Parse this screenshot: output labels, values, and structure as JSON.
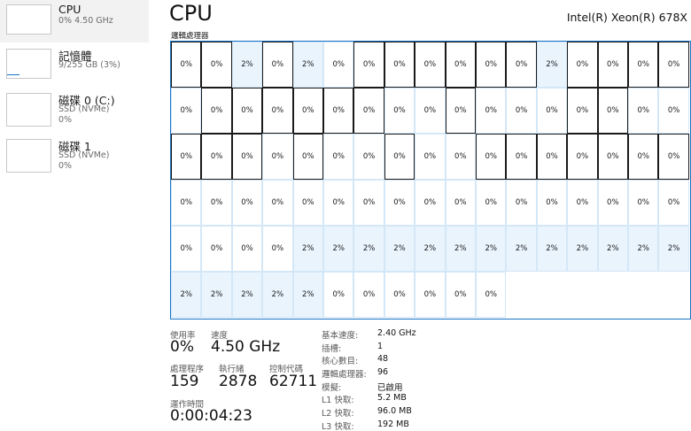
{
  "sidebar": {
    "items": [
      {
        "title": "CPU",
        "sub1": "0% 4.50 GHz",
        "sub2": ""
      },
      {
        "title": "記憶體",
        "sub1": "9/255 GB (3%)",
        "sub2": ""
      },
      {
        "title": "磁碟 0 (C:)",
        "sub1": "SSD (NVMe)",
        "sub2": "0%"
      },
      {
        "title": "磁碟 1",
        "sub1": "SSD (NVMe)",
        "sub2": "0%"
      }
    ]
  },
  "header": {
    "title": "CPU",
    "model": "Intel(R) Xeon(R) 678X"
  },
  "grid": {
    "label": "邏輯處理器",
    "cells": [
      "0%",
      "0%",
      "2%",
      "0%",
      "2%",
      "0%",
      "0%",
      "0%",
      "0%",
      "0%",
      "0%",
      "0%",
      "2%",
      "0%",
      "0%",
      "0%",
      "0%",
      "0%",
      "0%",
      "0%",
      "0%",
      "0%",
      "0%",
      "0%",
      "0%",
      "0%",
      "0%",
      "0%",
      "0%",
      "0%",
      "0%",
      "0%",
      "0%",
      "0%",
      "0%",
      "0%",
      "0%",
      "0%",
      "0%",
      "0%",
      "0%",
      "0%",
      "0%",
      "0%",
      "0%",
      "0%",
      "0%",
      "0%",
      "0%",
      "0%",
      "0%",
      "0%",
      "0%",
      "0%",
      "0%",
      "0%",
      "0%",
      "0%",
      "0%",
      "0%",
      "0%",
      "0%",
      "0%",
      "0%",
      "0%",
      "0%",
      "0%",
      "0%",
      "0%",
      "0%",
      "0%",
      "0%",
      "2%",
      "2%",
      "2%",
      "2%",
      "2%",
      "2%",
      "2%",
      "2%",
      "2%",
      "2%",
      "2%",
      "2%",
      "2%",
      "2%",
      "2%",
      "2%",
      "2%",
      "2%",
      "0%",
      "0%",
      "0%",
      "0%",
      "0%",
      "0%"
    ],
    "selected": [
      0,
      1,
      3,
      6,
      7,
      8,
      9,
      10,
      11,
      13,
      14,
      15,
      16,
      18,
      19,
      20,
      21,
      22,
      23,
      26,
      30,
      31,
      34,
      35,
      36,
      38,
      41,
      44,
      45,
      46,
      47,
      48,
      49,
      50
    ]
  },
  "stats": {
    "usage": {
      "label": "使用率",
      "value": "0%"
    },
    "speed": {
      "label": "速度",
      "value": "4.50 GHz"
    },
    "processes": {
      "label": "處理程序",
      "value": "159"
    },
    "threads": {
      "label": "執行緒",
      "value": "2878"
    },
    "handles": {
      "label": "控制代碼",
      "value": "62711"
    },
    "uptime": {
      "label": "運作時間",
      "value": "0:00:04:23"
    }
  },
  "specs": [
    {
      "key": "基本速度:",
      "value": "2.40 GHz"
    },
    {
      "key": "插槽:",
      "value": "1"
    },
    {
      "key": "核心數目:",
      "value": "48"
    },
    {
      "key": "邏輯處理器:",
      "value": "96"
    },
    {
      "key": "模擬:",
      "value": "已啟用"
    },
    {
      "key": "L1 快取:",
      "value": "5.2 MB"
    },
    {
      "key": "L2 快取:",
      "value": "96.0 MB"
    },
    {
      "key": "L3 快取:",
      "value": "192 MB"
    }
  ],
  "colors": {
    "accent": "#1772c6",
    "cell_border": "#d4e7f7",
    "cell_highlight": "#e9f4fd",
    "selected_bg": "#f2f2f2"
  }
}
